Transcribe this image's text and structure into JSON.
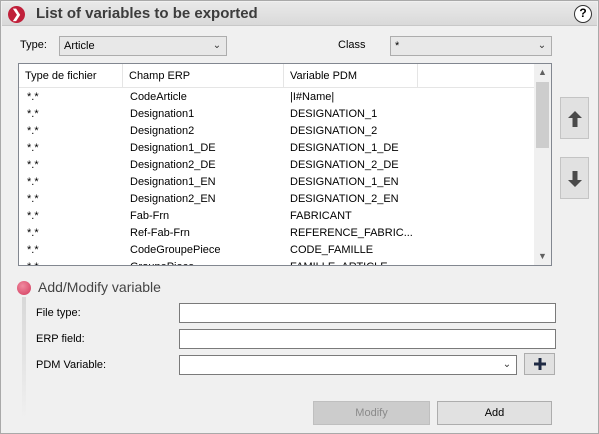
{
  "title": "List of variables to be exported",
  "help_label": "?",
  "type_label": "Type:",
  "type_value": "Article",
  "class_label": "Class",
  "class_value": "*",
  "columns": [
    "Type de fichier",
    "Champ ERP",
    "Variable PDM"
  ],
  "rows": [
    [
      "*.*",
      "CodeArticle",
      "|I#Name|"
    ],
    [
      "*.*",
      "Designation1",
      "DESIGNATION_1"
    ],
    [
      "*.*",
      "Designation2",
      "DESIGNATION_2"
    ],
    [
      "*.*",
      "Designation1_DE",
      "DESIGNATION_1_DE"
    ],
    [
      "*.*",
      "Designation2_DE",
      "DESIGNATION_2_DE"
    ],
    [
      "*.*",
      "Designation1_EN",
      "DESIGNATION_1_EN"
    ],
    [
      "*.*",
      "Designation2_EN",
      "DESIGNATION_2_EN"
    ],
    [
      "*.*",
      "Fab-Frn",
      "FABRICANT"
    ],
    [
      "*.*",
      "Ref-Fab-Frn",
      "REFERENCE_FABRIC..."
    ],
    [
      "*.*",
      "CodeGroupePiece",
      "CODE_FAMILLE"
    ],
    [
      "*.*",
      "GroupePiece",
      "FAMILLE_ARTICLE"
    ]
  ],
  "icons": {
    "title": "chevron-right-icon",
    "move_up": "arrow-up-icon",
    "move_down": "arrow-down-icon",
    "add_pdm": "plus-icon"
  },
  "section_title": "Add/Modify variable",
  "file_type_label": "File type:",
  "file_type_value": "",
  "erp_field_label": "ERP field:",
  "erp_field_value": "",
  "pdm_variable_label": "PDM Variable:",
  "pdm_variable_value": "",
  "modify_label": "Modify",
  "add_label": "Add",
  "colors": {
    "title_icon": "#c0203a",
    "section_dot": "#d23a5c"
  }
}
